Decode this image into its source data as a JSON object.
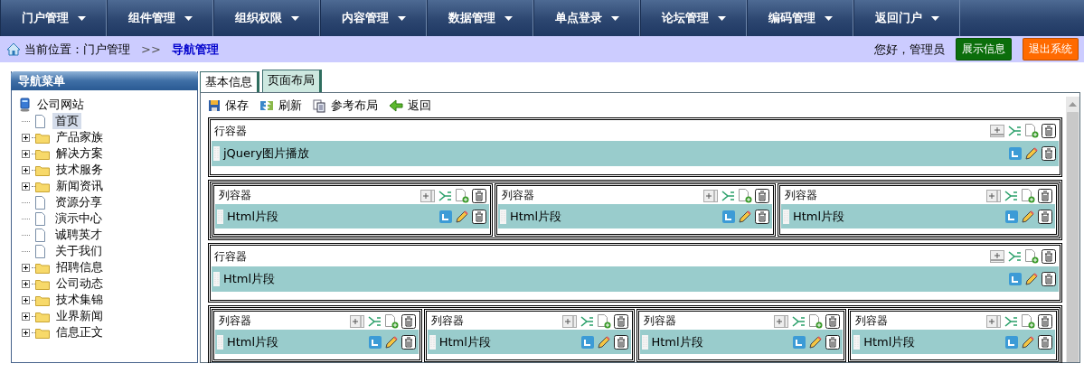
{
  "nav_menu": [
    {
      "label": "门户管理"
    },
    {
      "label": "组件管理"
    },
    {
      "label": "组织权限"
    },
    {
      "label": "内容管理"
    },
    {
      "label": "数据管理"
    },
    {
      "label": "单点登录"
    },
    {
      "label": "论坛管理"
    },
    {
      "label": "编码管理"
    },
    {
      "label": "返回门户"
    }
  ],
  "breadcrumb": {
    "prefix": "当前位置：门户管理",
    "separator": ">>",
    "current": "导航管理"
  },
  "user": {
    "greeting": "您好，管理员",
    "buttons": [
      {
        "label": "展示信息",
        "color": "#0b6e0b"
      },
      {
        "label": "退出系统",
        "color": "#ff6a00"
      }
    ]
  },
  "sidebar": {
    "title": "导航菜单",
    "tree": {
      "label": "公司网站",
      "children": [
        {
          "label": "首页",
          "kind": "page",
          "selected": true
        },
        {
          "label": "产品家族",
          "kind": "folder",
          "selected": false
        },
        {
          "label": "解决方案",
          "kind": "folder",
          "selected": false
        },
        {
          "label": "技术服务",
          "kind": "folder",
          "selected": false
        },
        {
          "label": "新闻资讯",
          "kind": "folder",
          "selected": false
        },
        {
          "label": "资源分享",
          "kind": "page",
          "selected": false
        },
        {
          "label": "演示中心",
          "kind": "page",
          "selected": false
        },
        {
          "label": "诚聘英才",
          "kind": "page",
          "selected": false
        },
        {
          "label": "关于我们",
          "kind": "page",
          "selected": false
        },
        {
          "label": "招聘信息",
          "kind": "folder",
          "selected": false
        },
        {
          "label": "公司动态",
          "kind": "folder",
          "selected": false
        },
        {
          "label": "技术集锦",
          "kind": "folder",
          "selected": false
        },
        {
          "label": "业界新闻",
          "kind": "folder",
          "selected": false
        },
        {
          "label": "信息正文",
          "kind": "folder",
          "selected": false
        }
      ]
    }
  },
  "tabs": [
    {
      "label": "基本信息",
      "selected": false
    },
    {
      "label": "页面布局",
      "selected": true
    }
  ],
  "toolbar": [
    {
      "label": "保存",
      "kind": "save"
    },
    {
      "label": "刷新",
      "kind": "refresh"
    },
    {
      "label": "参考布局",
      "kind": "copy"
    },
    {
      "label": "返回",
      "kind": "back"
    }
  ],
  "layout": [
    {
      "kind": "row",
      "title": "行容器",
      "widgets": [
        {
          "label": "jQuery图片播放"
        }
      ]
    },
    {
      "kind": "columns",
      "columns": [
        {
          "title": "列容器",
          "widgets": [
            {
              "label": "Html片段"
            }
          ]
        },
        {
          "title": "列容器",
          "widgets": [
            {
              "label": "Html片段"
            }
          ]
        },
        {
          "title": "列容器",
          "widgets": [
            {
              "label": "Html片段"
            }
          ]
        }
      ]
    },
    {
      "kind": "row",
      "title": "行容器",
      "widgets": [
        {
          "label": "Html片段"
        }
      ]
    },
    {
      "kind": "columns",
      "columns": [
        {
          "title": "列容器",
          "widgets": [
            {
              "label": "Html片段"
            }
          ]
        },
        {
          "title": "列容器",
          "widgets": [
            {
              "label": "Html片段"
            }
          ]
        },
        {
          "title": "列容器",
          "widgets": [
            {
              "label": "Html片段"
            }
          ]
        },
        {
          "title": "列容器",
          "widgets": [
            {
              "label": "Html片段"
            }
          ]
        }
      ]
    }
  ]
}
